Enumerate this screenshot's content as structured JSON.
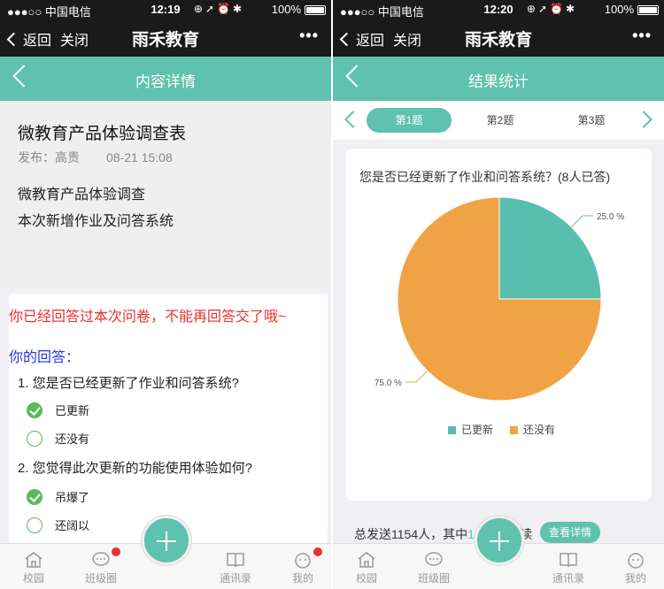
{
  "status_left": {
    "carrier": "●●●○○ 中国电信",
    "time": "12:19",
    "battery": "100%"
  },
  "status_right": {
    "carrier": "●●●○○ 中国电信",
    "time": "12:20",
    "battery": "100%"
  },
  "wechat": {
    "back": "返回",
    "close": "关闭",
    "title": "雨禾教育",
    "more": "•••"
  },
  "left": {
    "page_title": "内容详情",
    "article": {
      "title": "微教育产品体验调查表",
      "publisher": "发布：高贵",
      "date": "08-21 15:08",
      "line1": "微教育产品体验调查",
      "line2": "本次新增作业及问答系统"
    },
    "answers": {
      "warning": "你已经回答过本次问卷，不能再回答交了哦~",
      "heading": "你的回答：",
      "questions": [
        {
          "text": "1. 您是否已经更新了作业和问答系统?",
          "options": [
            {
              "label": "已更新",
              "checked": true
            },
            {
              "label": "还没有",
              "checked": false
            }
          ]
        },
        {
          "text": "2. 您觉得此次更新的功能使用体验如何?",
          "options": [
            {
              "label": "吊爆了",
              "checked": true
            },
            {
              "label": "还阔以",
              "checked": false
            }
          ]
        }
      ]
    }
  },
  "right": {
    "page_title": "结果统计",
    "tabs": [
      "第1题",
      "第2题",
      "第3题"
    ],
    "question": "您是否已经更新了作业和问答系统？(8人已答)",
    "summary_prefix": "总发送1154人，其中",
    "summary_highlight": "1070",
    "summary_suffix": "人未读",
    "detail_button": "查看详情"
  },
  "tabbar": {
    "items": [
      "校园",
      "班级圈",
      "通讯录",
      "我的"
    ]
  },
  "colors": {
    "accent": "#5ec2ae",
    "orange": "#f0a345",
    "teal": "#58bfaf"
  },
  "chart_data": {
    "type": "pie",
    "title": "您是否已经更新了作业和问答系统？(8人已答)",
    "categories": [
      "已更新",
      "还没有"
    ],
    "values": [
      25.0,
      75.0
    ],
    "value_labels": [
      "25.0 %",
      "75.0 %"
    ],
    "legend": "bottom"
  }
}
